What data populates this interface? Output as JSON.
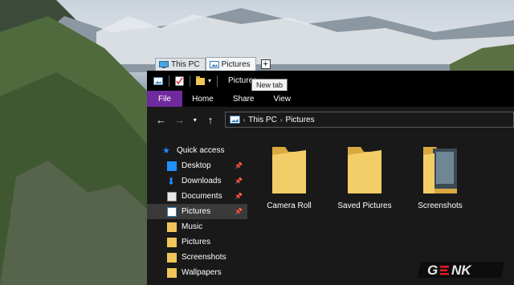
{
  "tabs": [
    {
      "label": "This PC"
    },
    {
      "label": "Pictures"
    }
  ],
  "new_tab_symbol": "+",
  "tooltip": "New tab",
  "window_title": "Pictures",
  "ribbon_tabs": [
    "File",
    "Home",
    "Share",
    "View"
  ],
  "breadcrumb": [
    "This PC",
    "Pictures"
  ],
  "nav": {
    "items": [
      {
        "label": "Quick access",
        "icon": "star-icon"
      },
      {
        "label": "Desktop",
        "icon": "desktop-folder-icon",
        "pinned": true
      },
      {
        "label": "Downloads",
        "icon": "download-icon",
        "pinned": true
      },
      {
        "label": "Documents",
        "icon": "documents-icon",
        "pinned": true
      },
      {
        "label": "Pictures",
        "icon": "pictures-icon",
        "pinned": true,
        "selected": true
      },
      {
        "label": "Music",
        "icon": "folder-icon"
      },
      {
        "label": "Pictures",
        "icon": "folder-icon"
      },
      {
        "label": "Screenshots",
        "icon": "folder-icon"
      },
      {
        "label": "Wallpapers",
        "icon": "folder-icon"
      }
    ]
  },
  "folders": [
    {
      "label": "Camera Roll"
    },
    {
      "label": "Saved Pictures"
    },
    {
      "label": "Screenshots"
    }
  ],
  "watermark": "GENK",
  "colors": {
    "file_tab": "#6f2a9e",
    "folder": "#f0c65a",
    "accent": "#1e90ff"
  }
}
